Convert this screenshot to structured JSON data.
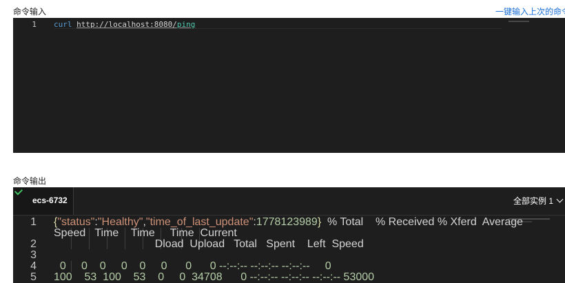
{
  "input": {
    "label": "命令输入",
    "fill_last_link": "一键输入上次的命令",
    "lines": [
      {
        "number": "1",
        "keyword": "curl",
        "url_main": "http://localhost:8080/",
        "url_end": "ping"
      }
    ]
  },
  "output": {
    "label": "命令输出",
    "instance_tab": "ecs-6732",
    "instance_tab_status": "success",
    "instance_select": "全部实例 1",
    "lines": [
      {
        "number": "1",
        "json_open": "{",
        "k1": "\"status\"",
        "c1": ":",
        "v1": "\"Healthy\"",
        "comma": ",",
        "k2": "\"time_of_last_update\"",
        "c2": ":",
        "v2": "1778123989",
        "json_close": "}",
        "rest": "  % Total    % Received % Xferd  Average"
      },
      {
        "number": "",
        "text": "Speed   Time    Time     Time  Current"
      },
      {
        "number": "2",
        "text": "                                 Dload  Upload   Total   Spent    Left  Speed"
      },
      {
        "number": "3",
        "text": ""
      },
      {
        "number": "4",
        "text": "  0     0    0     0    0     0      0      0 --:--:-- --:--:-- --:--:--     0"
      },
      {
        "number": "5",
        "text": "100    53  100    53    0     0  34708      0 --:--:-- --:--:-- --:--:-- 53000"
      }
    ]
  },
  "colors": {
    "editor_bg": "#1e1e1e",
    "link": "#1a6fd6",
    "success_check": "#3fbf5f",
    "json_string": "#ce9178",
    "json_number": "#b5cea8"
  },
  "icons": {
    "tab_status": "check-icon",
    "select_arrow": "chevron-down-icon"
  }
}
